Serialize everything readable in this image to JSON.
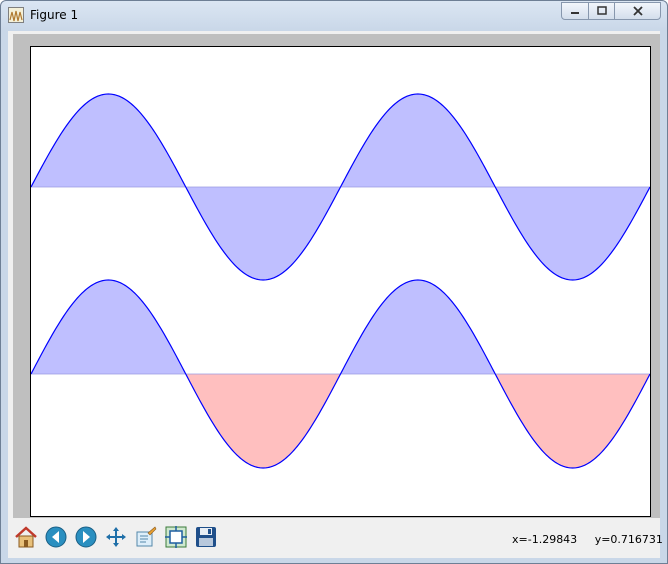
{
  "window": {
    "title": "Figure 1",
    "title_icon": "matplotlib-figure-icon",
    "controls": [
      "minimize-icon",
      "maximize-icon",
      "close-icon"
    ]
  },
  "toolbar": {
    "buttons": [
      {
        "name": "home-button",
        "icon": "home-icon"
      },
      {
        "name": "back-button",
        "icon": "back-arrow-icon"
      },
      {
        "name": "forward-button",
        "icon": "forward-arrow-icon"
      },
      {
        "name": "pan-button",
        "icon": "pan-move-icon"
      },
      {
        "name": "zoom-button",
        "icon": "zoom-rect-icon"
      },
      {
        "name": "subplots-button",
        "icon": "subplots-config-icon"
      },
      {
        "name": "save-button",
        "icon": "floppy-save-icon"
      }
    ]
  },
  "status": {
    "x_readout": "x=-1.29843",
    "y_readout": "y=0.716731"
  },
  "colors": {
    "line": "#0000ff",
    "fill_positive": "#bfbfff",
    "fill_negative_lower": "#ffbfbf",
    "figure_background": "#bfbfbf"
  },
  "chart_data": [
    {
      "type": "area",
      "function": "sin(2*pi*x)",
      "x": [
        0.0,
        0.25,
        0.5,
        0.75,
        1.0,
        1.25,
        1.5,
        1.75,
        2.0
      ],
      "y": [
        0.0,
        1.0,
        0.0,
        -1.0,
        0.0,
        1.0,
        0.0,
        -1.0,
        0.0
      ],
      "baseline": 0,
      "fill_above": "#bfbfff",
      "fill_below": "#bfbfff",
      "xlim": [
        0,
        2
      ],
      "ylim": [
        -1,
        1
      ]
    },
    {
      "type": "area",
      "function": "sin(2*pi*x)",
      "x": [
        0.0,
        0.25,
        0.5,
        0.75,
        1.0,
        1.25,
        1.5,
        1.75,
        2.0
      ],
      "y": [
        0.0,
        1.0,
        0.0,
        -1.0,
        0.0,
        1.0,
        0.0,
        -1.0,
        0.0
      ],
      "baseline": 0,
      "fill_above": "#bfbfff",
      "fill_below": "#ffbfbf",
      "xlim": [
        0,
        2
      ],
      "ylim": [
        -1,
        1
      ]
    }
  ]
}
